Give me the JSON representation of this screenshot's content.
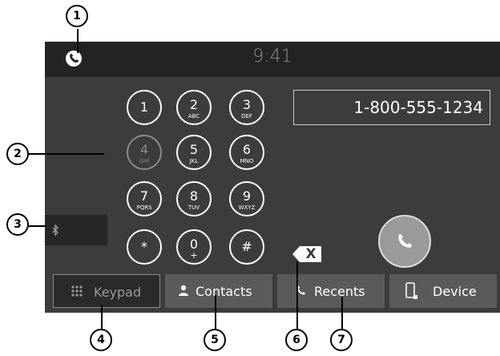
{
  "status": {
    "time": "9:41",
    "phone_icon": "phone-icon"
  },
  "keypad": {
    "keys": [
      {
        "digit": "1",
        "letters": ""
      },
      {
        "digit": "2",
        "letters": "ABC"
      },
      {
        "digit": "3",
        "letters": "DEF"
      },
      {
        "digit": "4",
        "letters": "GHI"
      },
      {
        "digit": "5",
        "letters": "JKL"
      },
      {
        "digit": "6",
        "letters": "MNO"
      },
      {
        "digit": "7",
        "letters": "PQRS"
      },
      {
        "digit": "8",
        "letters": "TUV"
      },
      {
        "digit": "9",
        "letters": "WXYZ"
      },
      {
        "digit": "*",
        "letters": ""
      },
      {
        "digit": "0",
        "letters": "+"
      },
      {
        "digit": "#",
        "letters": ""
      }
    ]
  },
  "dialed_number": "1-800-555-1234",
  "backspace_label": "X",
  "tabs": [
    {
      "label": "Keypad",
      "icon": "keypad-grid-icon"
    },
    {
      "label": "Contacts",
      "icon": "person-icon"
    },
    {
      "label": "Recents",
      "icon": "phone-icon"
    },
    {
      "label": "Device",
      "icon": "device-icon"
    }
  ],
  "callouts": [
    "1",
    "2",
    "3",
    "4",
    "5",
    "6",
    "7"
  ],
  "colors": {
    "screen": "#3c3c3c",
    "statusbar": "#232323",
    "tab": "#5a5a5a",
    "call_button": "#9a9a9a"
  }
}
